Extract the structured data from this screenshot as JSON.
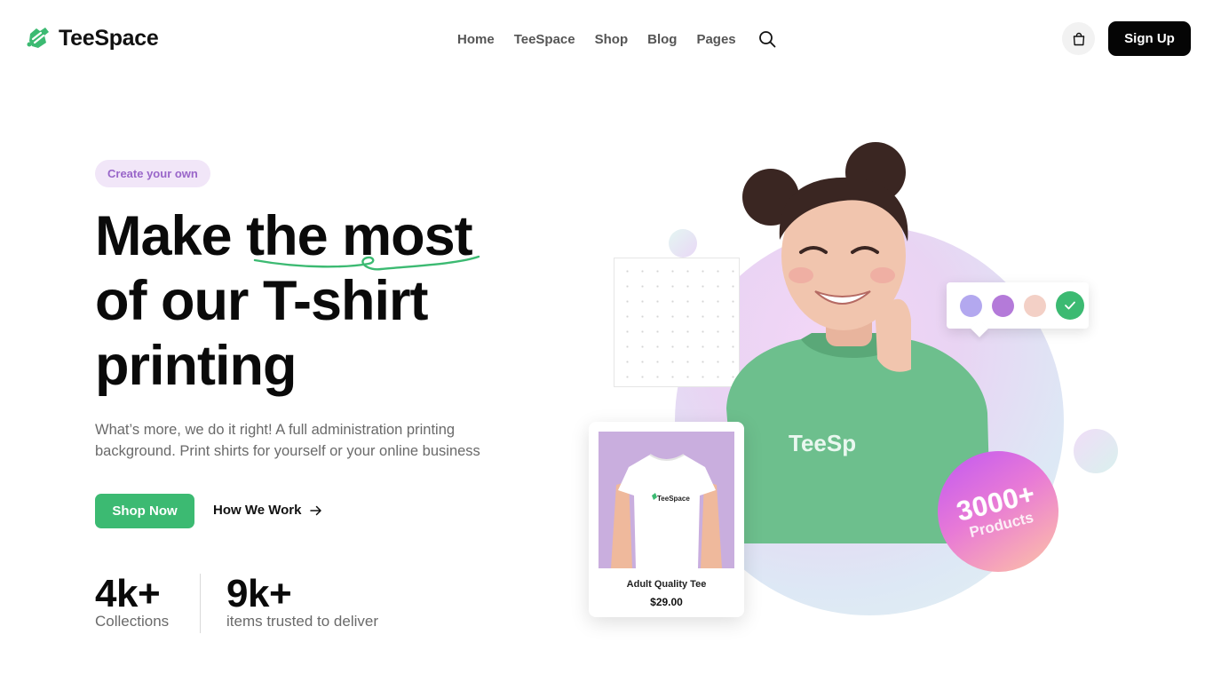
{
  "brand": {
    "name": "TeeSpace"
  },
  "nav": {
    "items": [
      {
        "label": "Home"
      },
      {
        "label": "TeeSpace"
      },
      {
        "label": "Shop"
      },
      {
        "label": "Blog"
      },
      {
        "label": "Pages"
      }
    ]
  },
  "header": {
    "signup_label": "Sign Up"
  },
  "hero": {
    "pill": "Create your own",
    "headline_line1_a": "Make ",
    "headline_line1_b": "the most",
    "headline_line2": "of our T-shirt",
    "headline_line3": "printing",
    "subtitle": "What’s more, we do it right! A full administration printing background. Print shirts for yourself or your online business",
    "primary_cta": "Shop Now",
    "secondary_cta": "How We Work",
    "stats": [
      {
        "value": "4k+",
        "label": "Collections"
      },
      {
        "value": "9k+",
        "label": "items trusted to deliver"
      }
    ]
  },
  "visual": {
    "hoodie_text": "TeeSp",
    "swatches": [
      {
        "color": "#b3a8ef"
      },
      {
        "color": "#b47ad9"
      },
      {
        "color": "#f3d0c6"
      },
      {
        "color": "#3cba72",
        "selected": true
      }
    ],
    "product": {
      "shirt_text": "TeeSpace",
      "name": "Adult Quality Tee",
      "price": "$29.00"
    },
    "badge": {
      "value": "3000+",
      "label": "Products"
    }
  },
  "colors": {
    "accent_green": "#3cba72",
    "pill_bg": "#f1e6f8",
    "pill_text": "#9966c9",
    "dark": "#050505"
  }
}
